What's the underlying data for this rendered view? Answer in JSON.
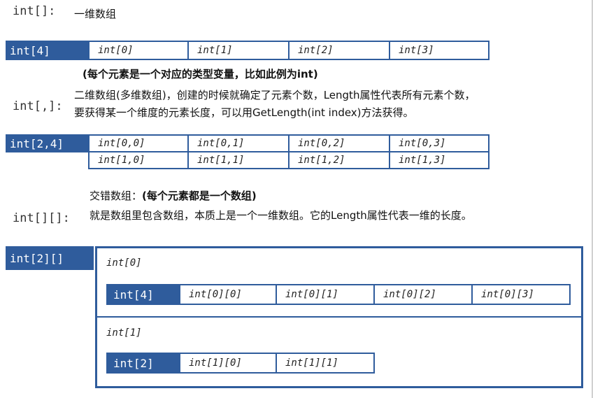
{
  "sec1": {
    "label": "int[]:",
    "desc": "一维数组",
    "header": "int[4]",
    "cells": [
      "int[0]",
      "int[1]",
      "int[2]",
      "int[3]"
    ],
    "note": "(每个元素是一个对应的类型变量，比如此例为int)"
  },
  "sec2": {
    "label": "int[,]:",
    "desc_line1": "二维数组(多维数组)，创建的时候就确定了元素个数，Length属性代表所有元素个数，",
    "desc_line2": "要获得某一个维度的元素长度，可以用GetLength(int index)方法获得。",
    "header": "int[2,4]",
    "rows": [
      [
        "int[0,0]",
        "int[0,1]",
        "int[0,2]",
        "int[0,3]"
      ],
      [
        "int[1,0]",
        "int[1,1]",
        "int[1,2]",
        "int[1,3]"
      ]
    ]
  },
  "sec3": {
    "label": "int[][]:",
    "desc_title_plain": "交错数组：",
    "desc_title_bold": "(每个元素都是一个数组)",
    "desc_line2": "就是数组里包含数组，本质上是一个一维数组。它的Length属性代表一维的长度。",
    "header": "int[2][]",
    "element0": {
      "label": "int[0]",
      "header": "int[4]",
      "cells": [
        "int[0][0]",
        "int[0][1]",
        "int[0][2]",
        "int[0][3]"
      ]
    },
    "element1": {
      "label": "int[1]",
      "header": "int[2]",
      "cells": [
        "int[1][0]",
        "int[1][1]"
      ]
    }
  },
  "colors": {
    "accent": "#2f5c9c",
    "background": "#ffffff",
    "text": "#111111"
  }
}
